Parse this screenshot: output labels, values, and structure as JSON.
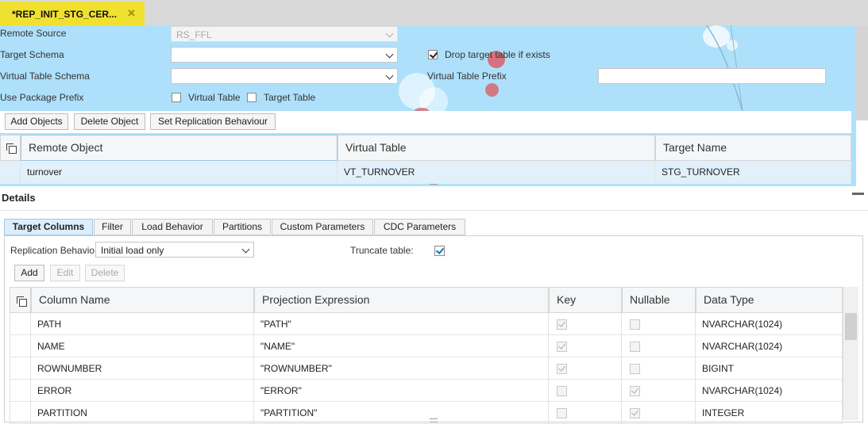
{
  "editor_tab": {
    "title": "*REP_INIT_STG_CER...",
    "close": "✕"
  },
  "form": {
    "remote_source": {
      "label": "Remote Source",
      "value": "RS_FFL"
    },
    "target_schema": {
      "label": "Target Schema",
      "value": ""
    },
    "virtual_table_schema": {
      "label": "Virtual Table Schema",
      "value": ""
    },
    "use_package_prefix": {
      "label": "Use Package Prefix",
      "virtual_table": "Virtual Table",
      "target_table": "Target Table"
    },
    "drop_target": {
      "label": "Drop target table if exists",
      "checked": true
    },
    "virtual_table_prefix": {
      "label": "Virtual Table Prefix",
      "value": ""
    }
  },
  "toolbar": {
    "add": "Add Objects",
    "delete": "Delete Object",
    "set_replication": "Set Replication Behaviour"
  },
  "objects_table": {
    "headers": [
      "Remote Object",
      "Virtual Table",
      "Target Name"
    ],
    "rows": [
      [
        "turnover",
        "VT_TURNOVER",
        "STG_TURNOVER"
      ]
    ]
  },
  "details": {
    "title": "Details",
    "tabs": [
      "Target Columns",
      "Filter",
      "Load Behavior",
      "Partitions",
      "Custom Parameters",
      "CDC Parameters"
    ],
    "active_tab": "Target Columns",
    "replication_label": "Replication Behavio",
    "replication_value": "Initial load only",
    "truncate_label": "Truncate table:",
    "truncate_checked": true,
    "buttons": {
      "add": "Add",
      "edit": "Edit",
      "delete": "Delete"
    },
    "columns_table": {
      "headers": [
        "Column Name",
        "Projection Expression",
        "Key",
        "Nullable",
        "Data Type"
      ],
      "rows": [
        {
          "name": "PATH",
          "expr": "\"PATH\"",
          "key": true,
          "nullable": false,
          "type": "NVARCHAR(1024)"
        },
        {
          "name": "NAME",
          "expr": "\"NAME\"",
          "key": true,
          "nullable": false,
          "type": "NVARCHAR(1024)"
        },
        {
          "name": "ROWNUMBER",
          "expr": "\"ROWNUMBER\"",
          "key": true,
          "nullable": false,
          "type": "BIGINT"
        },
        {
          "name": "ERROR",
          "expr": "\"ERROR\"",
          "key": false,
          "nullable": true,
          "type": "NVARCHAR(1024)"
        },
        {
          "name": "PARTITION",
          "expr": "\"PARTITION\"",
          "key": false,
          "nullable": true,
          "type": "INTEGER"
        }
      ]
    }
  },
  "colors": {
    "banner": "#aee0fb",
    "tab_yellow": "#f0e130",
    "active_tab": "#dceefc"
  }
}
